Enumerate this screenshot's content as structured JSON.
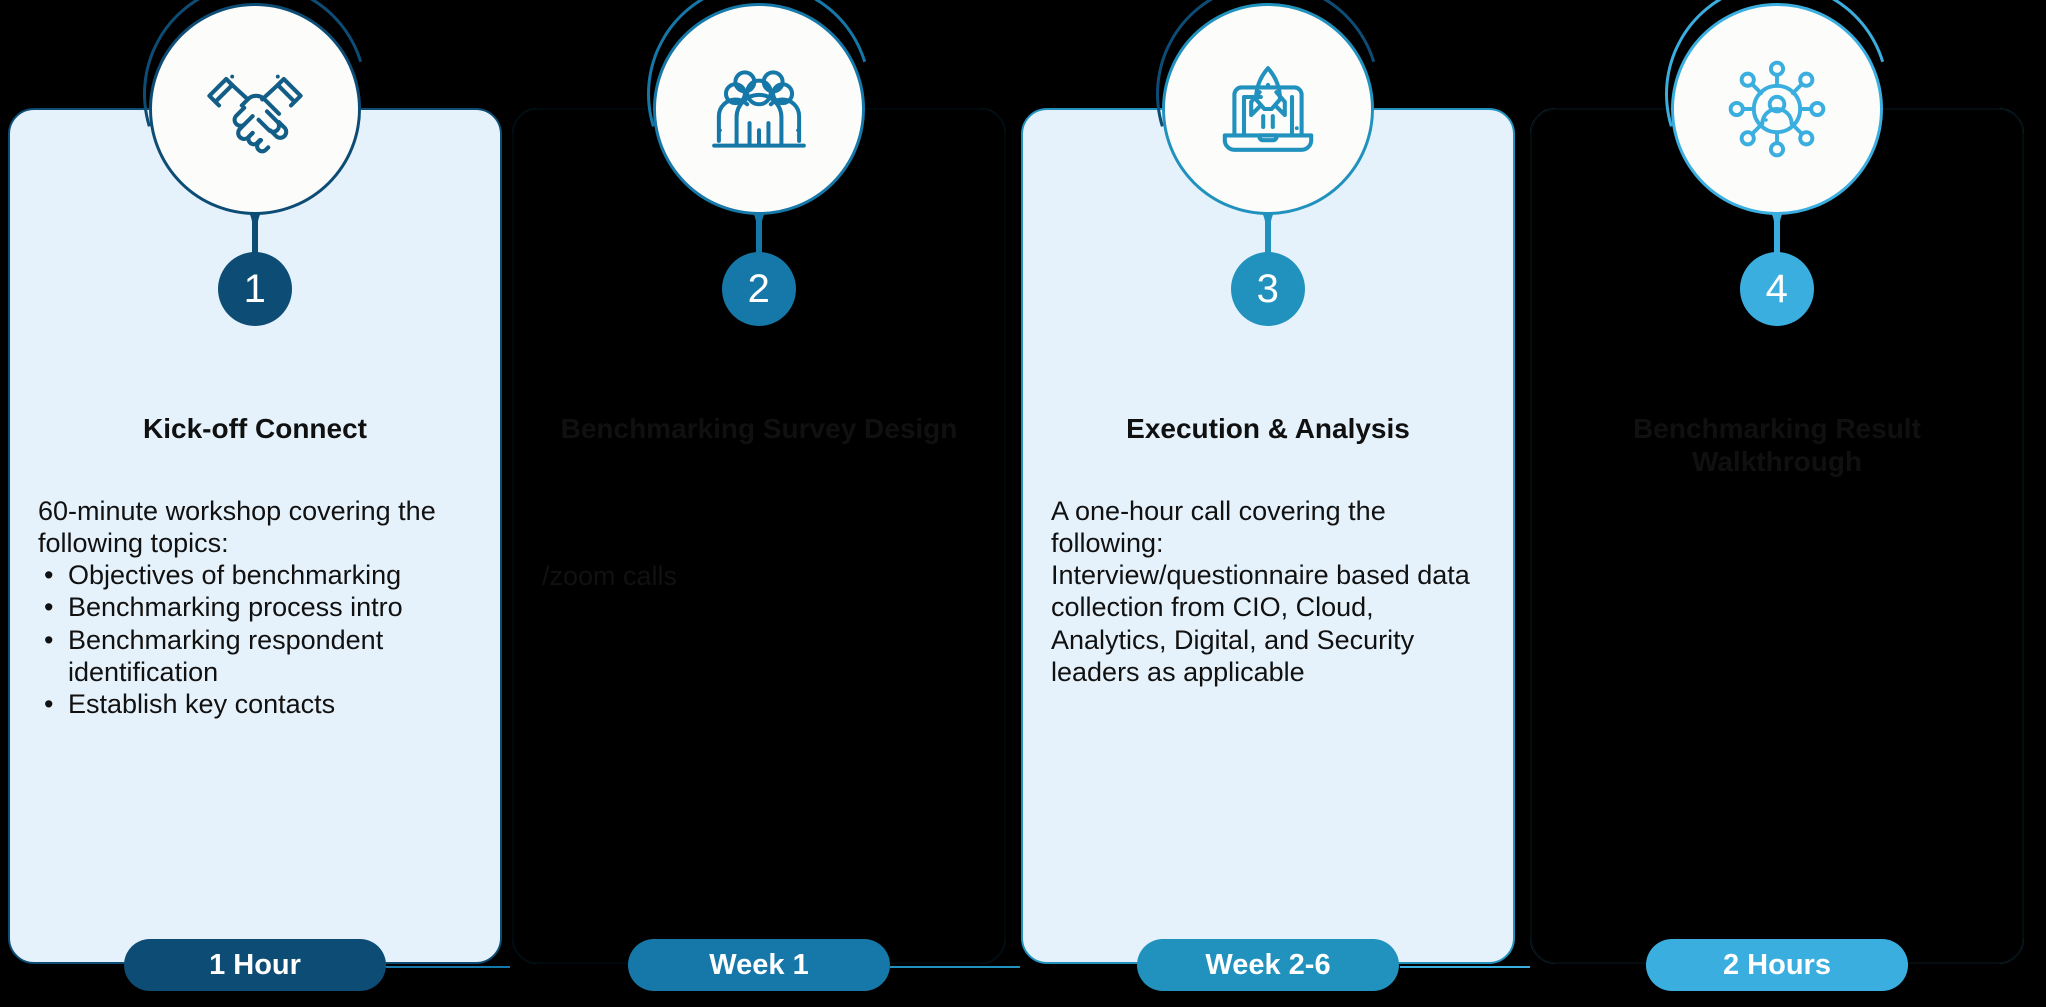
{
  "background_color": "#000000",
  "palette": {
    "navy": "#0D4C74",
    "blue_mid": "#1678A8",
    "blue_teal": "#2192BE",
    "blue_light": "#3BAEE0",
    "card_bg": "#E6F2FB",
    "text": "#101010"
  },
  "steps": [
    {
      "number": "1",
      "icon": "handshake-icon",
      "title": "Kick-off Connect",
      "intro": "60-minute workshop covering the following topics:",
      "bullets": [
        "Objectives of benchmarking",
        "Benchmarking process intro",
        "Benchmarking respondent identification",
        "Establish key contacts"
      ],
      "note": "",
      "pill_label": "1 Hour",
      "pill_color": "#0D4C74",
      "badge_color": "#0D4C74",
      "accent": "#0D4C74",
      "dimmed": false
    },
    {
      "number": "2",
      "icon": "people-group-icon",
      "title": "Benchmarking Survey Design",
      "intro": "",
      "bullets": [],
      "note": "/zoom calls",
      "pill_label": "Week 1",
      "pill_color": "#1678A8",
      "badge_color": "#1678A8",
      "accent": "#1678A8",
      "dimmed": true
    },
    {
      "number": "3",
      "icon": "rocket-laptop-icon",
      "title": "Execution & Analysis",
      "intro": "A one-hour call covering the following:",
      "bullets": [],
      "note": "Interview/questionnaire based data collection from CIO, Cloud, Analytics, Digital, and Security leaders as applicable",
      "pill_label": "Week 2-6",
      "pill_color": "#2192BE",
      "badge_color": "#2192BE",
      "accent": "#2192BE",
      "dimmed": false
    },
    {
      "number": "4",
      "icon": "network-user-icon",
      "title": "Benchmarking Result Walkthrough",
      "intro": "",
      "bullets": [],
      "note": "",
      "pill_label": "2 Hours",
      "pill_color": "#3BAEE0",
      "badge_color": "#3BAEE0",
      "accent": "#3BAEE0",
      "dimmed": true
    }
  ]
}
